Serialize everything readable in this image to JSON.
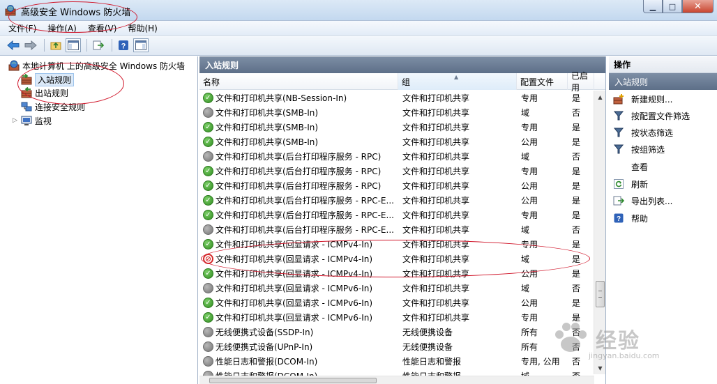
{
  "window": {
    "title": "高级安全 Windows 防火墙"
  },
  "menubar": {
    "items": [
      "文件(F)",
      "操作(A)",
      "查看(V)",
      "帮助(H)"
    ]
  },
  "tree": {
    "root": "本地计算机 上的高级安全 Windows 防火墙",
    "items": [
      {
        "label": "入站规则",
        "selected": true
      },
      {
        "label": "出站规则"
      },
      {
        "label": "连接安全规则"
      },
      {
        "label": "监视"
      }
    ]
  },
  "middle": {
    "header": "入站规则",
    "columns": [
      "名称",
      "组",
      "配置文件",
      "已启用"
    ],
    "rows": [
      {
        "name": "文件和打印机共享(NB-Session-In)",
        "group": "文件和打印机共享",
        "profile": "专用",
        "enabled": "是",
        "status": "green"
      },
      {
        "name": "文件和打印机共享(SMB-In)",
        "group": "文件和打印机共享",
        "profile": "域",
        "enabled": "否",
        "status": "gray"
      },
      {
        "name": "文件和打印机共享(SMB-In)",
        "group": "文件和打印机共享",
        "profile": "专用",
        "enabled": "是",
        "status": "green"
      },
      {
        "name": "文件和打印机共享(SMB-In)",
        "group": "文件和打印机共享",
        "profile": "公用",
        "enabled": "是",
        "status": "green"
      },
      {
        "name": "文件和打印机共享(后台打印程序服务 - RPC)",
        "group": "文件和打印机共享",
        "profile": "域",
        "enabled": "否",
        "status": "gray"
      },
      {
        "name": "文件和打印机共享(后台打印程序服务 - RPC)",
        "group": "文件和打印机共享",
        "profile": "专用",
        "enabled": "是",
        "status": "green"
      },
      {
        "name": "文件和打印机共享(后台打印程序服务 - RPC)",
        "group": "文件和打印机共享",
        "profile": "公用",
        "enabled": "是",
        "status": "green"
      },
      {
        "name": "文件和打印机共享(后台打印程序服务 - RPC-E...",
        "group": "文件和打印机共享",
        "profile": "公用",
        "enabled": "是",
        "status": "green"
      },
      {
        "name": "文件和打印机共享(后台打印程序服务 - RPC-E...",
        "group": "文件和打印机共享",
        "profile": "专用",
        "enabled": "是",
        "status": "green"
      },
      {
        "name": "文件和打印机共享(后台打印程序服务 - RPC-E...",
        "group": "文件和打印机共享",
        "profile": "域",
        "enabled": "否",
        "status": "gray"
      },
      {
        "name": "文件和打印机共享(回显请求 - ICMPv4-In)",
        "group": "文件和打印机共享",
        "profile": "专用",
        "enabled": "是",
        "status": "green"
      },
      {
        "name": "文件和打印机共享(回显请求 - ICMPv4-In)",
        "group": "文件和打印机共享",
        "profile": "域",
        "enabled": "是",
        "status": "block"
      },
      {
        "name": "文件和打印机共享(回显请求 - ICMPv4-In)",
        "group": "文件和打印机共享",
        "profile": "公用",
        "enabled": "是",
        "status": "green"
      },
      {
        "name": "文件和打印机共享(回显请求 - ICMPv6-In)",
        "group": "文件和打印机共享",
        "profile": "域",
        "enabled": "否",
        "status": "gray"
      },
      {
        "name": "文件和打印机共享(回显请求 - ICMPv6-In)",
        "group": "文件和打印机共享",
        "profile": "公用",
        "enabled": "是",
        "status": "green"
      },
      {
        "name": "文件和打印机共享(回显请求 - ICMPv6-In)",
        "group": "文件和打印机共享",
        "profile": "专用",
        "enabled": "是",
        "status": "green"
      },
      {
        "name": "无线便携式设备(SSDP-In)",
        "group": "无线便携设备",
        "profile": "所有",
        "enabled": "否",
        "status": "gray"
      },
      {
        "name": "无线便携式设备(UPnP-In)",
        "group": "无线便携设备",
        "profile": "所有",
        "enabled": "否",
        "status": "gray"
      },
      {
        "name": "性能日志和警报(DCOM-In)",
        "group": "性能日志和警报",
        "profile": "专用, 公用",
        "enabled": "否",
        "status": "gray"
      },
      {
        "name": "性能日志和警报(DCOM-In)",
        "group": "性能日志和警报",
        "profile": "域",
        "enabled": "否",
        "status": "gray"
      }
    ]
  },
  "actions": {
    "header": "操作",
    "section": "入站规则",
    "items": [
      {
        "label": "新建规则...",
        "icon": "new-rule-icon"
      },
      {
        "label": "按配置文件筛选",
        "icon": "filter-icon"
      },
      {
        "label": "按状态筛选",
        "icon": "filter-icon"
      },
      {
        "label": "按组筛选",
        "icon": "filter-icon"
      },
      {
        "label": "查看",
        "icon": "none"
      },
      {
        "label": "刷新",
        "icon": "refresh-icon"
      },
      {
        "label": "导出列表...",
        "icon": "export-icon"
      },
      {
        "label": "帮助",
        "icon": "help-icon"
      }
    ]
  },
  "watermark": {
    "text": "经验",
    "url": "jingyan.baidu.com"
  },
  "colors": {
    "accent": "#5d6f88",
    "annotation": "#d0162a"
  }
}
